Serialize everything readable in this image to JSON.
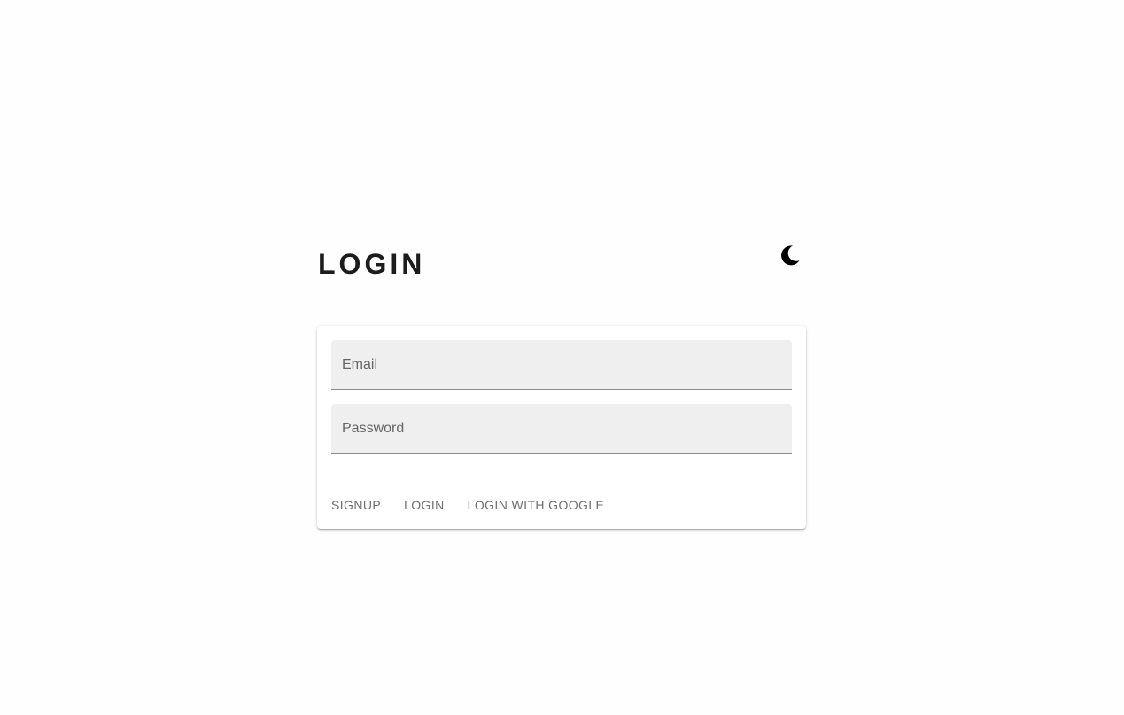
{
  "header": {
    "title": "LOGIN",
    "theme_toggle_icon": "moon-icon"
  },
  "form": {
    "email": {
      "placeholder": "Email",
      "value": ""
    },
    "password": {
      "placeholder": "Password",
      "value": ""
    },
    "actions": {
      "signup_label": "SIGNUP",
      "login_label": "LOGIN",
      "google_label": "LOGIN WITH GOOGLE"
    }
  },
  "colors": {
    "background": "#fdfefd",
    "field_background": "#efefef",
    "button_text": "#6f6f6f",
    "title_text": "#1c1c1c"
  }
}
